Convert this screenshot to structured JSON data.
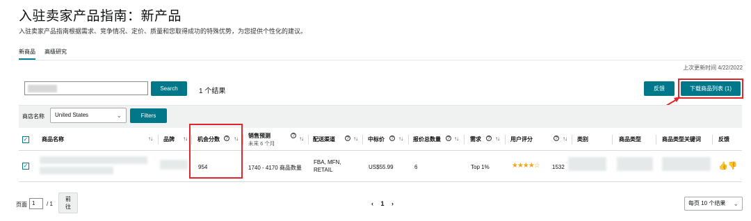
{
  "header": {
    "title": "入驻卖家产品指南：新产品",
    "subtitle": "入驻卖家产品指南根据需求、竞争情况、定价、质量和您取得成功的特殊优势，为您提供个性化的建议。"
  },
  "tabs": [
    {
      "label": "新商品",
      "active": true
    },
    {
      "label": "高级研究",
      "active": false
    }
  ],
  "last_updated": "上次更新时间 4/22/2022",
  "toolbar": {
    "search_button": "Search",
    "result_count": "1 个结果",
    "feedback_button": "反馈",
    "download_button": "下载商品列表 (1)"
  },
  "filters": {
    "store_label": "商店名称",
    "store_value": "United States",
    "filters_button": "Filters"
  },
  "table": {
    "columns": {
      "name": "商品名称",
      "brand": "品牌",
      "opportunity": "机会分数",
      "sales_forecast": "销售预测",
      "sales_forecast_sub": "未来 6 个月",
      "fulfillment": "配送渠道",
      "median_price": "中标价",
      "offer_count": "报价总数量",
      "demand": "需求",
      "rating": "用户评分",
      "category": "类别",
      "product_type": "商品类型",
      "type_keywords": "商品类型关键词",
      "feedback": "反馈"
    },
    "rows": [
      {
        "opportunity": "954",
        "sales_forecast": "1740 - 4170 商品数量",
        "fulfillment_line1": "FBA, MFN,",
        "fulfillment_line2": "RETAIL",
        "median_price": "US$55.99",
        "offer_count": "6",
        "demand": "Top 1%",
        "rating_stars": 4.5,
        "rating_count": "1532"
      }
    ]
  },
  "pagination": {
    "page_label": "页面",
    "page_value": "1",
    "total": "/ 1",
    "go_button_line1": "前",
    "go_button_line2": "往",
    "prev": "‹",
    "current": "1",
    "next": "›",
    "per_page": "每页 10 个结果"
  },
  "colors": {
    "accent": "#00788a",
    "highlight": "#e0262a",
    "star": "#f0a41e"
  },
  "icons": {
    "sort": "sort-arrows-icon",
    "help": "help-circle-icon",
    "thumbs": "thumbs-up-down-icon",
    "chevron": "chevron-down-icon"
  }
}
